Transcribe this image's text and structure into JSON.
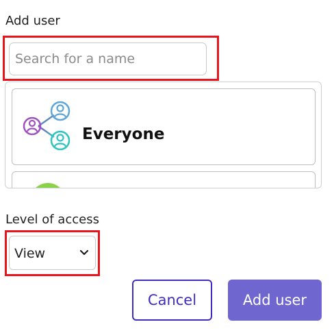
{
  "add_user": {
    "label": "Add user",
    "search_placeholder": "Search for a name"
  },
  "list": {
    "items": [
      {
        "label": "Everyone",
        "icon": "group-icon"
      }
    ]
  },
  "access": {
    "label": "Level of access",
    "selected": "View"
  },
  "actions": {
    "cancel_label": "Cancel",
    "add_label": "Add user"
  },
  "colors": {
    "highlight": "#e8141c",
    "primary": "#6f67cf",
    "outline_button": "#3e2cc2",
    "icon_purple": "#8a4fc4",
    "icon_teal": "#2ec4c0"
  }
}
